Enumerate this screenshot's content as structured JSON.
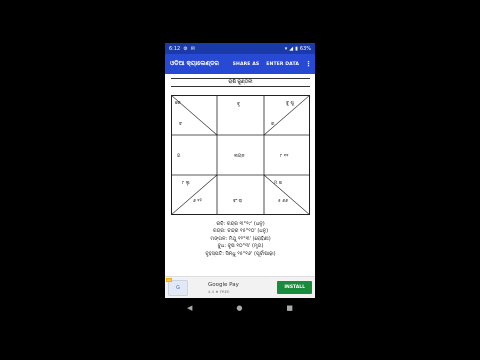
{
  "statusbar": {
    "time": "6:12",
    "icons": [
      "settings-icon",
      "notification-icon"
    ],
    "battery": "63%"
  },
  "appbar": {
    "title": "ଓଡିଆ କ୍ୟାଲେଣ୍ଡର",
    "share_label": "SHARE AS",
    "enter_label": "ENTER DATA",
    "menu_glyph": "⋮"
  },
  "chart": {
    "title": "ରାଶି କୁଣ୍ଡଳୀ",
    "cells": {
      "top_left_a": "କେ",
      "top_left_b": "ଚ",
      "top_mid": "ବୃ",
      "top_right_a": "ବୁ ଶୁ",
      "top_right_b": "ର",
      "mid_left": "ଗ",
      "center": "ଲଗ୍ନ",
      "mid_right": "୮ ୧୧",
      "bottom_left_a": "୮ ଲୁ",
      "bottom_left_b": "୬ ୧୨",
      "bottom_mid": "ବଂ ରା",
      "bottom_right_a": "ମ ଶ",
      "bottom_right_b": "୫ ୬୬"
    }
  },
  "positions": [
    "ରବି: ଚନ୍ଦ୍ର ୩°୨୯' (ଧନୁ)",
    "ଚନ୍ଦ୍ର: ଚନ୍ଦ୍ର ୧୫°୨୦' (ଧନୁ)",
    "ମଙ୍ଗଳ: ମିଥୁ ୧୨°୩' (ରୋହିଣୀ)",
    "ବୁଧ: ବୃଷ ୧୦°୩' (ମୃଗ)",
    "ବୃହସ୍ପତି: ସିନ୍ଧୁ ୨୫°୧୬' (ପୂର୍ବାଷାଢ଼ା)"
  ],
  "ad": {
    "badge": "Ad",
    "app_name": "Google Pay",
    "rating": "4.4 ★ FREE",
    "install_label": "INSTALL"
  },
  "navbar": {
    "back": "◀",
    "home": "●",
    "recents": "■"
  },
  "colors": {
    "appbar": "#2749d4",
    "statusbar": "#1a3aa8",
    "install": "#1a8a3c"
  }
}
